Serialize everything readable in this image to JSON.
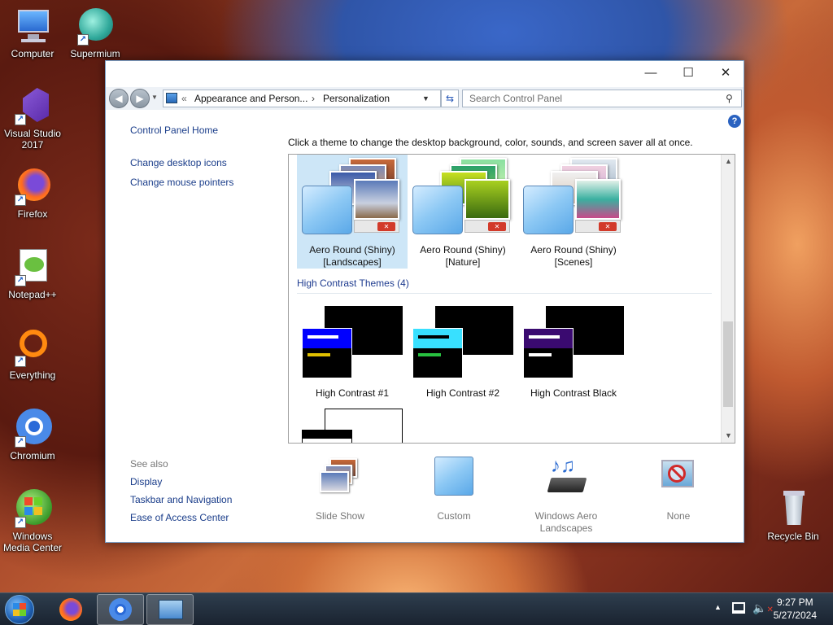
{
  "desktop": {
    "icons": [
      {
        "label": "Computer"
      },
      {
        "label": "Supermium"
      },
      {
        "label": "Visual Studio 2017"
      },
      {
        "label": "Firefox"
      },
      {
        "label": "Notepad++"
      },
      {
        "label": "Everything"
      },
      {
        "label": "Chromium"
      },
      {
        "label": "Windows Media Center"
      },
      {
        "label": "Recycle Bin"
      }
    ]
  },
  "window": {
    "controls": {
      "minimize": "—",
      "maximize": "☐",
      "close": "✕"
    },
    "address": {
      "chevron": "«",
      "crumb1": "Appearance and Person...",
      "separator": "›",
      "crumb2": "Personalization"
    },
    "search_placeholder": "Search Control Panel",
    "left_nav": {
      "home": "Control Panel Home",
      "desktop_icons": "Change desktop icons",
      "mouse_pointers": "Change mouse pointers"
    },
    "instruction": "Click a theme to change the desktop background, color, sounds, and screen saver all at once.",
    "themes": [
      {
        "line1": "Aero Round (Shiny)",
        "line2": "[Landscapes]",
        "selected": true
      },
      {
        "line1": "Aero Round (Shiny)",
        "line2": "[Nature]",
        "selected": false
      },
      {
        "line1": "Aero Round (Shiny)",
        "line2": "[Scenes]",
        "selected": false
      }
    ],
    "high_contrast_heading": "High Contrast Themes (4)",
    "high_contrast": [
      {
        "label": "High Contrast #1",
        "bar": "#0000ff",
        "line1": "#ffffff",
        "line2": "#e0c000"
      },
      {
        "label": "High Contrast #2",
        "bar": "#38e0ff",
        "line1": "#000000",
        "line2": "#28c040"
      },
      {
        "label": "High Contrast Black",
        "bar": "#3a0a70",
        "line1": "#ffffff",
        "line2": "#ffffff"
      }
    ],
    "see_also": {
      "heading": "See also",
      "display": "Display",
      "taskbar": "Taskbar and Navigation",
      "ease": "Ease of Access Center"
    },
    "bottom_items": [
      {
        "label": "Slide Show"
      },
      {
        "label": "Custom"
      },
      {
        "label": "Windows Aero Landscapes"
      },
      {
        "label": "None"
      }
    ]
  },
  "taskbar": {
    "time": "9:27 PM",
    "date": "5/27/2024",
    "tray_arrow": "▲"
  }
}
